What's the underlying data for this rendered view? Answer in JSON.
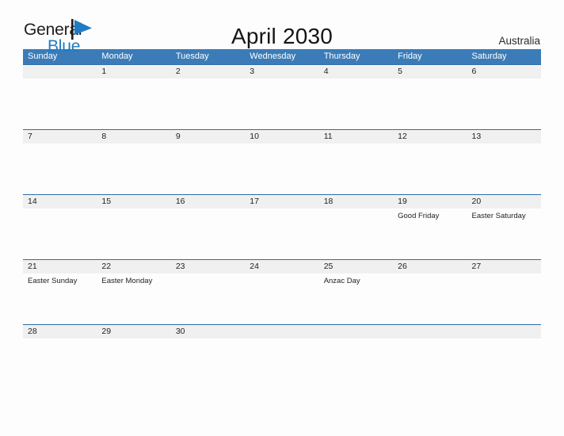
{
  "brand": {
    "name_top": "General",
    "name_bottom": "Blue",
    "flag_icon": "flag-icon",
    "accent_color": "#1f7bc4"
  },
  "header": {
    "title": "April 2030",
    "region": "Australia"
  },
  "calendar": {
    "header_bg": "#3b7cb8",
    "date_band_bg": "#f0f0f0",
    "row_border_color": "#2f6ea8",
    "weekdays": [
      "Sunday",
      "Monday",
      "Tuesday",
      "Wednesday",
      "Thursday",
      "Friday",
      "Saturday"
    ],
    "weeks": [
      {
        "days": [
          {
            "date": "",
            "event": ""
          },
          {
            "date": "1",
            "event": ""
          },
          {
            "date": "2",
            "event": ""
          },
          {
            "date": "3",
            "event": ""
          },
          {
            "date": "4",
            "event": ""
          },
          {
            "date": "5",
            "event": ""
          },
          {
            "date": "6",
            "event": ""
          }
        ]
      },
      {
        "days": [
          {
            "date": "7",
            "event": ""
          },
          {
            "date": "8",
            "event": ""
          },
          {
            "date": "9",
            "event": ""
          },
          {
            "date": "10",
            "event": ""
          },
          {
            "date": "11",
            "event": ""
          },
          {
            "date": "12",
            "event": ""
          },
          {
            "date": "13",
            "event": ""
          }
        ]
      },
      {
        "days": [
          {
            "date": "14",
            "event": ""
          },
          {
            "date": "15",
            "event": ""
          },
          {
            "date": "16",
            "event": ""
          },
          {
            "date": "17",
            "event": ""
          },
          {
            "date": "18",
            "event": ""
          },
          {
            "date": "19",
            "event": "Good Friday"
          },
          {
            "date": "20",
            "event": "Easter Saturday"
          }
        ]
      },
      {
        "days": [
          {
            "date": "21",
            "event": "Easter Sunday"
          },
          {
            "date": "22",
            "event": "Easter Monday"
          },
          {
            "date": "23",
            "event": ""
          },
          {
            "date": "24",
            "event": ""
          },
          {
            "date": "25",
            "event": "Anzac Day"
          },
          {
            "date": "26",
            "event": ""
          },
          {
            "date": "27",
            "event": ""
          }
        ]
      },
      {
        "days": [
          {
            "date": "28",
            "event": ""
          },
          {
            "date": "29",
            "event": ""
          },
          {
            "date": "30",
            "event": ""
          },
          {
            "date": "",
            "event": ""
          },
          {
            "date": "",
            "event": ""
          },
          {
            "date": "",
            "event": ""
          },
          {
            "date": "",
            "event": ""
          }
        ]
      }
    ]
  }
}
